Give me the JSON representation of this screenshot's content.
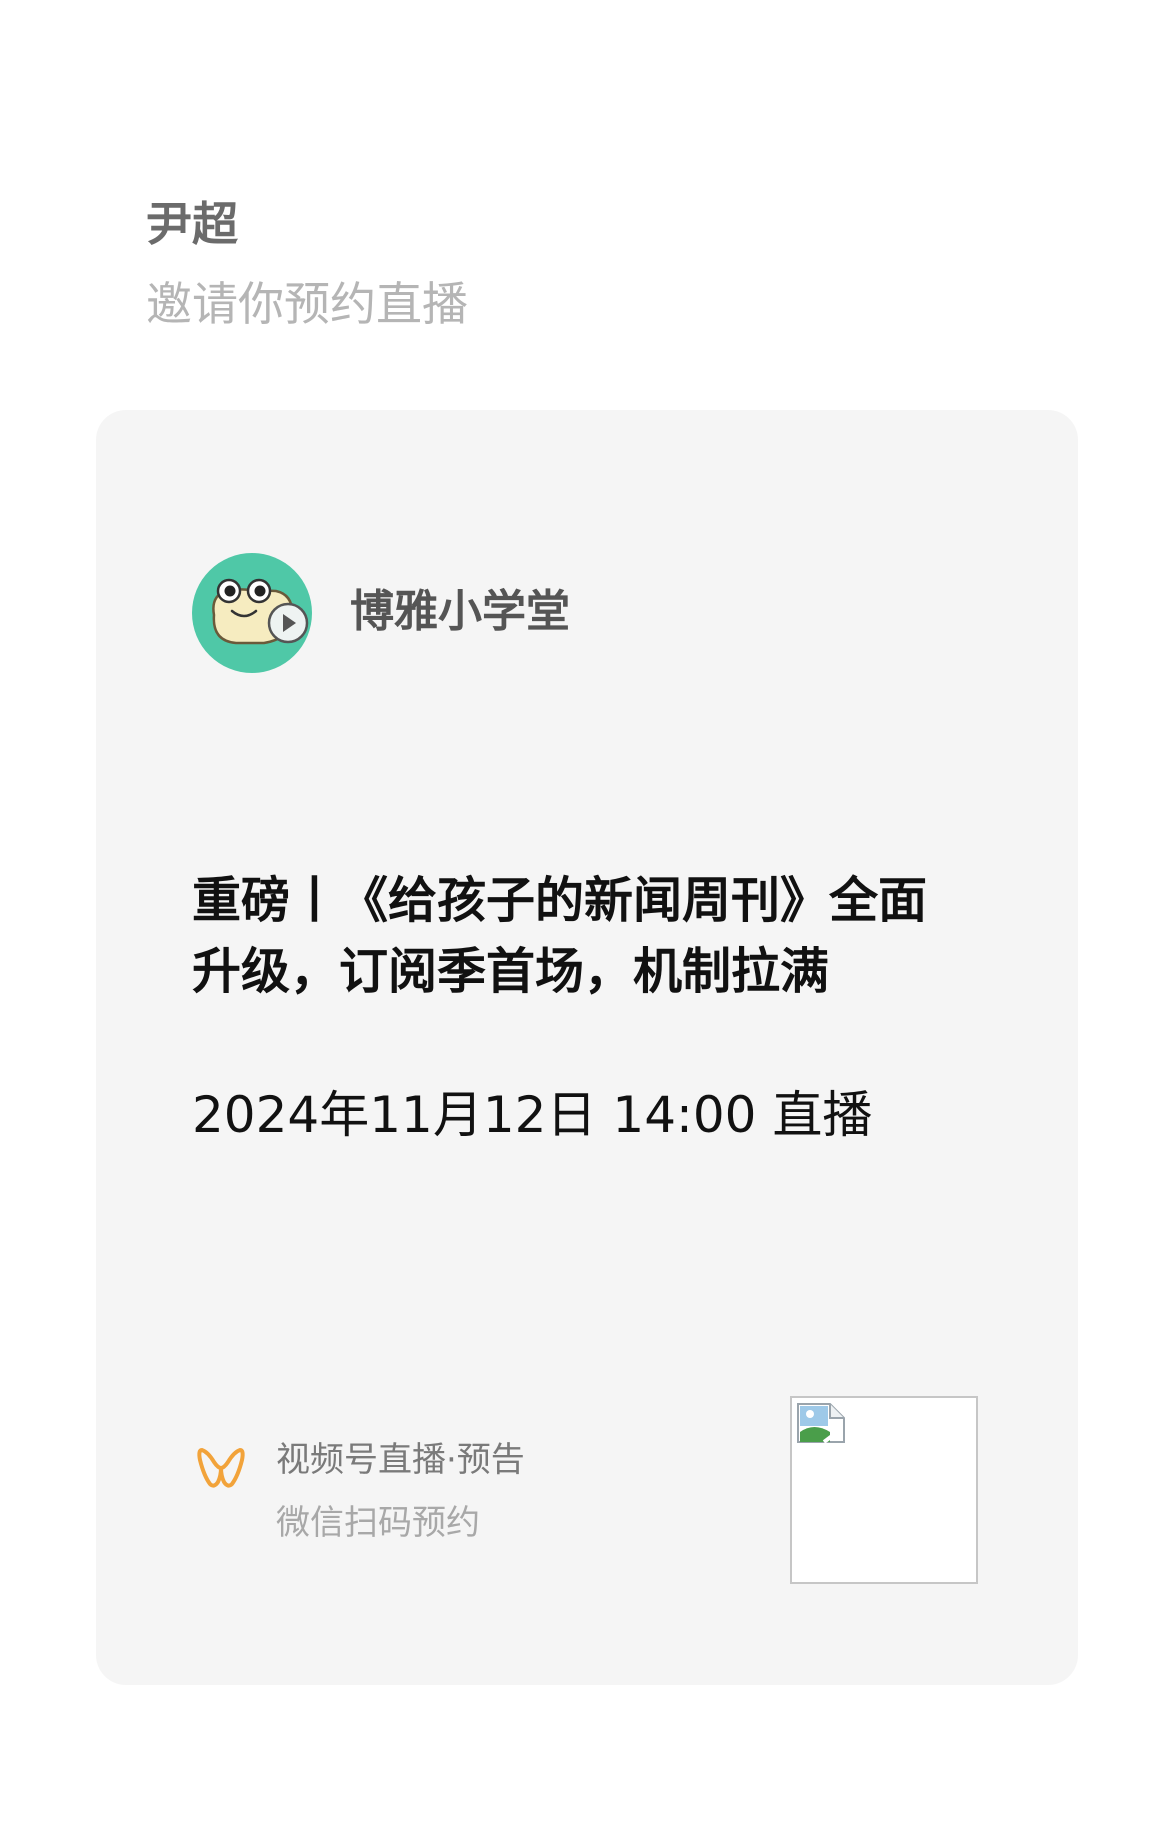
{
  "invite": {
    "inviter_name": "尹超",
    "message": "邀请你预约直播"
  },
  "card": {
    "channel": {
      "name": "博雅小学堂",
      "avatar_icon": "snail-mascot-avatar"
    },
    "live_title": "重磅丨《给孩子的新闻周刊》全面升级，订阅季首场，机制拉满",
    "live_time": "2024年11月12日 14:00 直播",
    "footer": {
      "brand_icon": "wechat-channels-icon",
      "label": "视频号直播·预告",
      "subtitle": "微信扫码预约"
    },
    "qr_code": {
      "state": "broken-image-placeholder"
    }
  },
  "colors": {
    "card_background": "#f5f5f5",
    "brand_accent": "#f2a33a",
    "avatar_background": "#4fc8a7"
  }
}
